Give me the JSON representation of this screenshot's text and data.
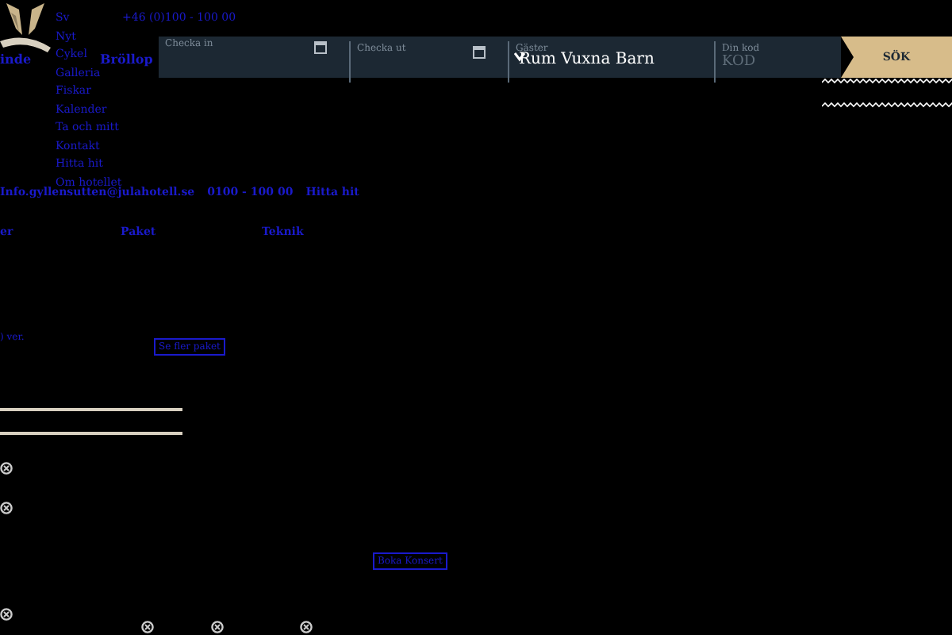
{
  "header": {
    "phone": "+46 (0)100 - 100 00",
    "nav": [
      "Sv",
      "Nyt",
      "Cykel",
      "Galleria",
      "Fiskar",
      "Kalender",
      "Ta och mitt",
      "Kontakt",
      "Hitta hit",
      "Om hotellet"
    ],
    "main_nav": [
      "inde",
      "Bröllop"
    ]
  },
  "booking": {
    "fields": [
      {
        "kind": "date",
        "label": "Checka in"
      },
      {
        "kind": "date",
        "label": "Checka ut"
      },
      {
        "kind": "guests",
        "label": "Gäster",
        "value": "Rum Vuxna Barn"
      },
      {
        "kind": "code",
        "label": "Din kod",
        "placeholder": "KOD"
      }
    ],
    "button": "SÖK"
  },
  "contact": [
    "Info.gyllensutten@julahotell.se",
    "0100 - 100 00",
    "Hitta hit"
  ],
  "tabs": [
    "er",
    "Paket",
    "Teknik"
  ],
  "more_text": ") ver.",
  "packages_button": "Se fler paket",
  "concert_button": "Boka Konsert"
}
